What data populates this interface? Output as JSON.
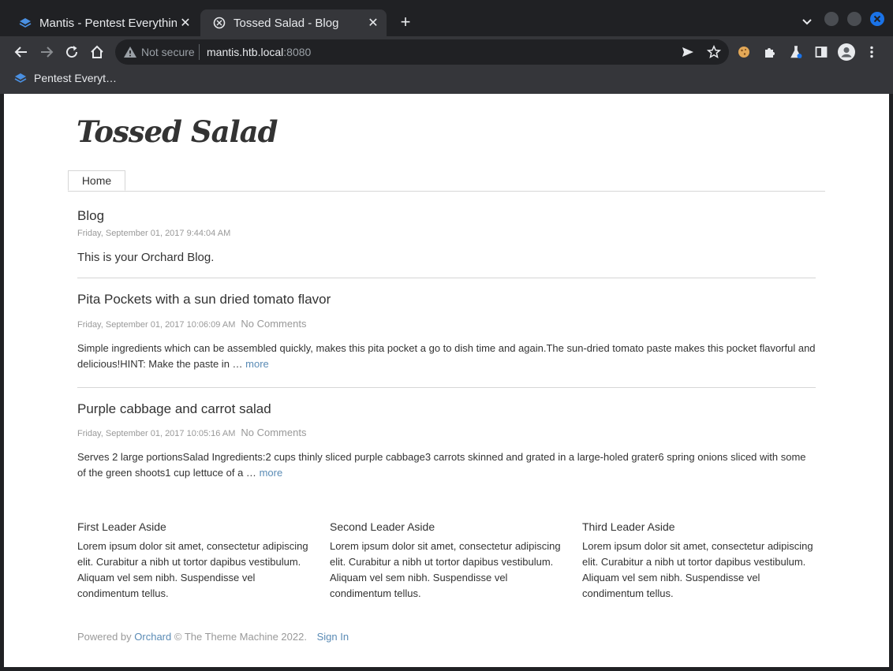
{
  "browser": {
    "tabs": [
      {
        "title": "Mantis - Pentest Everything",
        "favicon": "layers-icon"
      },
      {
        "title": "Tossed Salad - Blog",
        "favicon": "orchard-icon"
      }
    ],
    "address": {
      "security_label": "Not secure",
      "host": "mantis.htb.local",
      "port": ":8080"
    },
    "bookmarks": [
      {
        "label": "Pentest Everyt…",
        "favicon": "layers-icon"
      }
    ],
    "colors": {
      "frame": "#202124",
      "toolbar": "#35363a",
      "accent": "#1a73e8"
    }
  },
  "site": {
    "title": "Tossed Salad",
    "menu": [
      "Home"
    ]
  },
  "blog": {
    "heading": "Blog",
    "date": "Friday, September 01, 2017 9:44:04 AM",
    "intro": "This is your Orchard Blog."
  },
  "posts": [
    {
      "title": "Pita Pockets with a sun dried tomato flavor",
      "date": "Friday, September 01, 2017 10:06:09 AM",
      "comments": "No Comments",
      "excerpt": "Simple ingredients which can be assembled quickly, makes this pita pocket a go to dish time and again.The sun-dried tomato paste makes this pocket flavorful and delicious!HINT:  Make the paste in …",
      "more": "more"
    },
    {
      "title": "Purple cabbage and carrot salad",
      "date": "Friday, September 01, 2017 10:05:16 AM",
      "comments": "No Comments",
      "excerpt": "Serves 2 large portionsSalad Ingredients:2 cups thinly sliced purple cabbage3 carrots skinned and grated in a large-holed grater6 spring onions sliced with some of the green shoots1 cup lettuce of a …",
      "more": "more"
    }
  ],
  "asides": [
    {
      "title": "First Leader Aside",
      "text": "Lorem ipsum dolor sit amet, consectetur adipiscing elit. Curabitur a nibh ut tortor dapibus vestibulum. Aliquam vel sem nibh. Suspendisse vel condimentum tellus."
    },
    {
      "title": "Second Leader Aside",
      "text": "Lorem ipsum dolor sit amet, consectetur adipiscing elit. Curabitur a nibh ut tortor dapibus vestibulum. Aliquam vel sem nibh. Suspendisse vel condimentum tellus."
    },
    {
      "title": "Third Leader Aside",
      "text": "Lorem ipsum dolor sit amet, consectetur adipiscing elit. Curabitur a nibh ut tortor dapibus vestibulum. Aliquam vel sem nibh. Suspendisse vel condimentum tellus."
    }
  ],
  "footer": {
    "powered_by": "Powered by",
    "orchard_link": "Orchard",
    "copyright": "© The Theme Machine 2022.",
    "sign_in": "Sign In"
  }
}
